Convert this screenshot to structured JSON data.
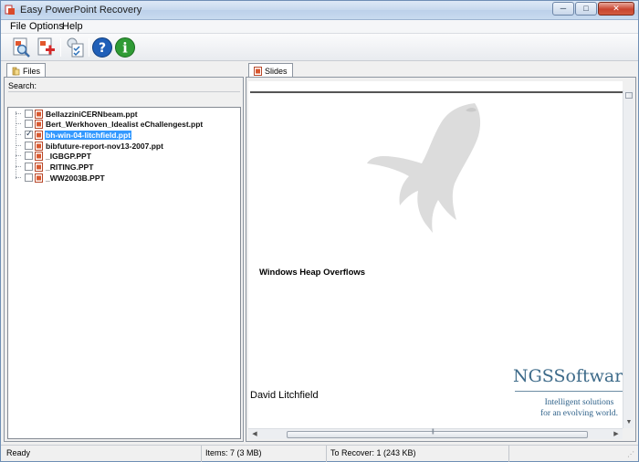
{
  "window": {
    "title": "Easy PowerPoint Recovery",
    "controls": {
      "minimize": "─",
      "maximize": "□",
      "close": "✕"
    }
  },
  "menu": {
    "items": [
      "File",
      "Options",
      "Help"
    ]
  },
  "toolbar": {
    "buttons": [
      {
        "name": "open-files-button",
        "icon": "magnifier-document-icon"
      },
      {
        "name": "add-recovery-button",
        "icon": "document-plus-icon"
      },
      {
        "name": "recover-button",
        "icon": "clipboard-check-icon"
      },
      {
        "name": "help-button",
        "icon": "question-icon",
        "glyph": "?"
      },
      {
        "name": "about-button",
        "icon": "info-icon",
        "glyph": "i"
      }
    ]
  },
  "left_pane": {
    "tab_label": "Files",
    "search_label": "Search:",
    "search_value": "",
    "files": [
      {
        "name": "BellazziniCERNbeam.ppt",
        "checked": false,
        "selected": false
      },
      {
        "name": "Bert_Werkhoven_Idealist eChallengest.ppt",
        "checked": false,
        "selected": false
      },
      {
        "name": "bh-win-04-litchfield.ppt",
        "checked": true,
        "selected": true
      },
      {
        "name": "bibfuture-report-nov13-2007.ppt",
        "checked": false,
        "selected": false
      },
      {
        "name": "_IGBGP.PPT",
        "checked": false,
        "selected": false
      },
      {
        "name": "_RITING.PPT",
        "checked": false,
        "selected": false
      },
      {
        "name": "_WW2003B.PPT",
        "checked": false,
        "selected": false
      }
    ]
  },
  "right_pane": {
    "tab_label": "Slides",
    "slide": {
      "title": "Windows Heap Overflows",
      "author": "David Litchfield",
      "logo_text": "NGSSoftware",
      "tagline_line1": "Intelligent solutions",
      "tagline_line2": "for an evolving world."
    }
  },
  "status": {
    "state": "Ready",
    "items": "Items: 7 (3 MB)",
    "to_recover": "To Recover: 1 (243 KB)"
  },
  "colors": {
    "selection": "#3399ff",
    "logo": "#3e6b8a",
    "help_icon": "#1f5fb8",
    "info_icon": "#2f9b35"
  }
}
